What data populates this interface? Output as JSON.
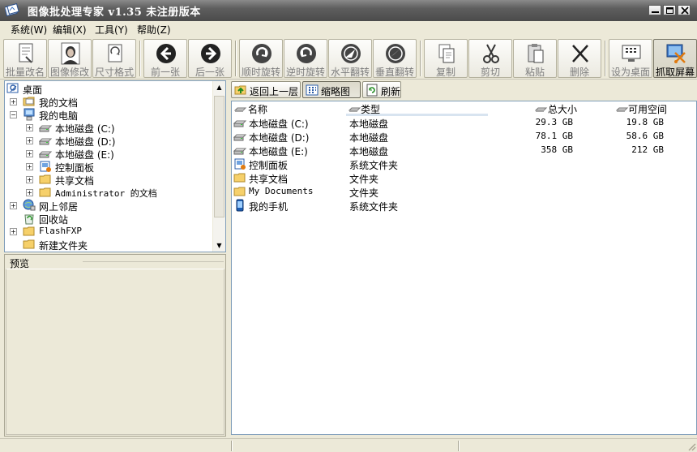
{
  "window": {
    "title": "图像批处理专家 v1.35 未注册版本"
  },
  "menu": [
    {
      "label": "系统(W)"
    },
    {
      "label": "编辑(X)"
    },
    {
      "label": "工具(Y)"
    },
    {
      "label": "帮助(Z)"
    }
  ],
  "toolbar": {
    "buttons": [
      {
        "label": "批量改名",
        "icon": "batch-rename-icon",
        "enabled": false
      },
      {
        "label": "图像修改",
        "icon": "portrait-icon",
        "enabled": false
      },
      {
        "label": "尺寸格式",
        "icon": "resize-icon",
        "enabled": false
      },
      {
        "label": "前一张",
        "icon": "arrow-left-icon",
        "enabled": false
      },
      {
        "label": "后一张",
        "icon": "arrow-right-icon",
        "enabled": false
      },
      {
        "label": "顺时旋转",
        "icon": "rotate-cw-icon",
        "enabled": false
      },
      {
        "label": "逆时旋转",
        "icon": "rotate-ccw-icon",
        "enabled": false
      },
      {
        "label": "水平翻转",
        "icon": "flip-horizontal-icon",
        "enabled": false
      },
      {
        "label": "垂直翻转",
        "icon": "flip-vertical-icon",
        "enabled": false
      },
      {
        "label": "复制",
        "icon": "copy-icon",
        "enabled": false
      },
      {
        "label": "剪切",
        "icon": "scissors-icon",
        "enabled": false
      },
      {
        "label": "粘贴",
        "icon": "paste-icon",
        "enabled": false
      },
      {
        "label": "删除",
        "icon": "delete-x-icon",
        "enabled": false
      },
      {
        "label": "设为桌面",
        "icon": "desktop-icon",
        "enabled": false
      },
      {
        "label": "抓取屏幕",
        "icon": "screen-capture-icon",
        "enabled": true
      }
    ]
  },
  "tree": {
    "items": [
      {
        "label": "桌面",
        "icon": "desktop-icon"
      },
      {
        "label": "我的文档",
        "icon": "folder-icon"
      },
      {
        "label": "我的电脑",
        "icon": "computer-icon"
      },
      {
        "label": "本地磁盘 (C:)",
        "icon": "drive-icon"
      },
      {
        "label": "本地磁盘 (D:)",
        "icon": "drive-icon"
      },
      {
        "label": "本地磁盘 (E:)",
        "icon": "drive-icon"
      },
      {
        "label": "控制面板",
        "icon": "control-panel-icon"
      },
      {
        "label": "共享文档",
        "icon": "folder-icon"
      },
      {
        "label": "Administrator 的文档",
        "icon": "folder-icon"
      },
      {
        "label": "网上邻居",
        "icon": "network-icon"
      },
      {
        "label": "回收站",
        "icon": "recycle-bin-icon"
      },
      {
        "label": "FlashFXP",
        "icon": "folder-icon"
      },
      {
        "label": "新建文件夹",
        "icon": "folder-icon"
      }
    ]
  },
  "preview": {
    "label": "预览"
  },
  "nav": {
    "back_label": "返回上一层",
    "thumbnail_label": "缩略图",
    "refresh_label": "刷新"
  },
  "list": {
    "columns": [
      "名称",
      "类型",
      "总大小",
      "可用空间"
    ],
    "rows": [
      {
        "name": "本地磁盘 (C:)",
        "type": "本地磁盘",
        "total": "29.3 GB",
        "free": "19.8 GB",
        "icon": "drive-icon"
      },
      {
        "name": "本地磁盘 (D:)",
        "type": "本地磁盘",
        "total": "78.1 GB",
        "free": "58.6 GB",
        "icon": "drive-icon"
      },
      {
        "name": "本地磁盘 (E:)",
        "type": "本地磁盘",
        "total": "358 GB",
        "free": "212 GB",
        "icon": "drive-icon"
      },
      {
        "name": "控制面板",
        "type": "系统文件夹",
        "total": "",
        "free": "",
        "icon": "control-panel-icon"
      },
      {
        "name": "共享文档",
        "type": "文件夹",
        "total": "",
        "free": "",
        "icon": "folder-icon"
      },
      {
        "name": "My Documents",
        "type": "文件夹",
        "total": "",
        "free": "",
        "icon": "folder-icon"
      },
      {
        "name": "我的手机",
        "type": "系统文件夹",
        "total": "",
        "free": "",
        "icon": "phone-icon"
      }
    ]
  }
}
